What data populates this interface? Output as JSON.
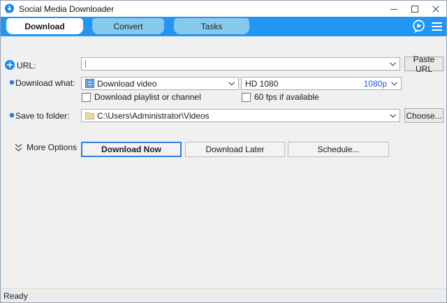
{
  "window": {
    "title": "Social Media Downloader",
    "controls": {
      "minimize": "minimize",
      "maximize": "maximize",
      "close": "close"
    }
  },
  "tabs": [
    {
      "label": "Download",
      "active": true
    },
    {
      "label": "Convert",
      "active": false
    },
    {
      "label": "Tasks",
      "active": false
    }
  ],
  "form": {
    "url": {
      "label": "URL:",
      "value": "",
      "paste_button": "Paste URL"
    },
    "download_what": {
      "label": "Download what:",
      "selected": "Download video",
      "quality": {
        "name": "HD 1080",
        "tag": "1080p"
      }
    },
    "checkboxes": [
      {
        "label": "Download playlist or channel",
        "checked": false
      },
      {
        "label": "60 fps if available",
        "checked": false
      }
    ],
    "save_to": {
      "label": "Save to folder:",
      "value": "C:\\Users\\Administrator\\Videos",
      "choose_button": "Choose..."
    },
    "more_options_label": "More Options",
    "action_buttons": {
      "primary": "Download Now",
      "secondary": "Download Later",
      "tertiary": "Schedule..."
    }
  },
  "status_bar": {
    "text": "Ready"
  },
  "icons": {
    "app": "speech-bubble-download",
    "strip_right": [
      "messenger-play-bubble",
      "hamburger-menu"
    ],
    "url_row": "plus-circle",
    "video_combo": "filmstrip",
    "folder_combo": "folder",
    "more_options": "double-chevron-down"
  },
  "colors": {
    "accent_blue": "#2196F3",
    "tab_inactive": "#87CAEE",
    "link_blue": "#1E5AD6",
    "primary_border": "#2D7FE0",
    "icon_blue": "#1E88E5",
    "folder_tan": "#E7D9A6"
  }
}
